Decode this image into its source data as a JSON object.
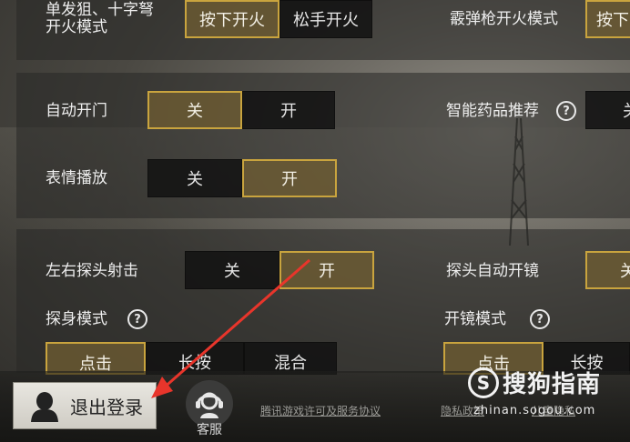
{
  "colors": {
    "accent_border": "#c9a43e",
    "active_fill": "#6e5c32",
    "inactive_fill": "#101010",
    "arrow_red": "#e8352b"
  },
  "settings": {
    "single_fire": {
      "label_line1": "单发狙、十字弩",
      "label_line2": "开火模式",
      "options": [
        "按下开火",
        "松手开火"
      ],
      "selected": "按下开火"
    },
    "shotgun_fire": {
      "label": "霰弹枪开火模式",
      "options": [
        "按下"
      ],
      "selected": "按下"
    },
    "auto_door": {
      "label": "自动开门",
      "options": [
        "关",
        "开"
      ],
      "selected": "关"
    },
    "smart_medicine": {
      "label": "智能药品推荐",
      "help_icon": "question-icon",
      "options": [
        "关"
      ]
    },
    "emote_play": {
      "label": "表情播放",
      "options": [
        "关",
        "开"
      ],
      "selected": "开"
    },
    "peek_fire": {
      "label": "左右探头射击",
      "options": [
        "关",
        "开"
      ],
      "selected": "开"
    },
    "peek_auto_scope": {
      "label": "探头自动开镜",
      "options": [
        "关"
      ],
      "selected": "关"
    },
    "peek_mode": {
      "label": "探身模式",
      "help_icon": "question-icon",
      "options": [
        "点击",
        "长按",
        "混合"
      ],
      "selected": "点击"
    },
    "scope_mode": {
      "label": "开镜模式",
      "help_icon": "question-icon",
      "options": [
        "点击",
        "长按"
      ],
      "selected": "点击"
    }
  },
  "footer": {
    "logout_label": "退出登录",
    "logout_icon": "user-silhouette-icon",
    "service_icon": "headset-icon",
    "service_label": "客服",
    "link_license": "腾讯游戏许可及服务协议",
    "link_privacy": "隐私政策",
    "link_children": "儿童隐私"
  },
  "watermark": {
    "logo_glyph": "S",
    "name": "搜狗指南",
    "domain": "zhinan.sogou.com"
  }
}
